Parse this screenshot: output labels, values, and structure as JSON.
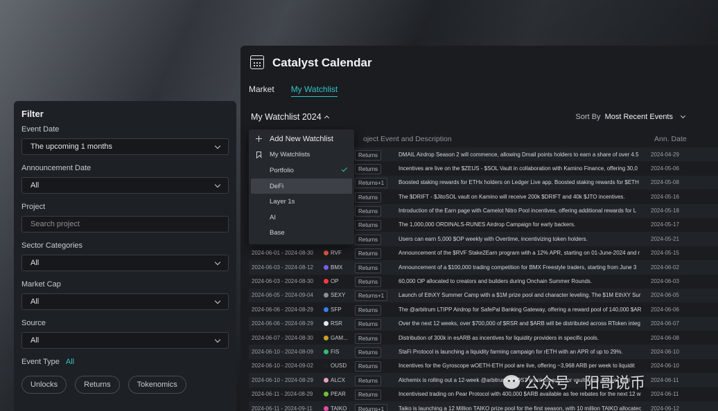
{
  "filter": {
    "title": "Filter",
    "event_date_label": "Event Date",
    "event_date_value": "The upcoming 1 months",
    "announcement_date_label": "Announcement Date",
    "announcement_date_value": "All",
    "project_label": "Project",
    "project_placeholder": "Search project",
    "sector_label": "Sector Categories",
    "sector_value": "All",
    "market_cap_label": "Market Cap",
    "market_cap_value": "All",
    "source_label": "Source",
    "source_value": "All",
    "event_type_label": "Event Type",
    "event_type_value": "All",
    "chips": [
      "Unlocks",
      "Returns",
      "Tokenomics"
    ]
  },
  "main": {
    "title": "Catalyst Calendar",
    "tabs": [
      "Market",
      "My Watchlist"
    ],
    "watchlist_select": "My Watchlist 2024",
    "sort_label": "Sort By",
    "sort_value": "Most Recent Events",
    "columns": {
      "project": "oject",
      "event": "Event and Description",
      "ann_date": "Ann. Date"
    }
  },
  "dropdown": {
    "add": "Add New Watchlist",
    "my_watchlists": "My Watchlists",
    "items": [
      "Portfolio",
      "DeFi",
      "Layer 1s",
      "AI",
      "Base"
    ]
  },
  "rows": [
    {
      "date": "",
      "project": "",
      "color": "",
      "type": "Returns",
      "desc": "DMAIL Airdrop Season 2 will commence, allowing Dmail points holders to earn a share of over 4.5",
      "ann": "2024-04-29"
    },
    {
      "date": "",
      "project": "",
      "color": "",
      "type": "Returns",
      "desc": "Incentives are live on the $ZEUS - $SOL Vault in collaboration with Kamino Finance, offering 30,0",
      "ann": "2024-05-06"
    },
    {
      "date": "",
      "project": "",
      "color": "",
      "type": "Returns+1",
      "desc": "Boosted staking rewards for ETHx holders on Ledger Live app. Boosted staking rewards for $ETH",
      "ann": "2024-05-08"
    },
    {
      "date": "",
      "project": "",
      "color": "",
      "type": "Returns",
      "desc": "The $DRIFT - $JitoSOL vault on Kamino will receive 200k $DRIFT and 40k $JTO incentives.",
      "ann": "2024-05-16"
    },
    {
      "date": "",
      "project": "",
      "color": "",
      "type": "Returns",
      "desc": "Introduction of the Earn page with Camelot Nitro Pool incentives, offering additional rewards for L",
      "ann": "2024-05-18"
    },
    {
      "date": "",
      "project": "",
      "color": "",
      "type": "Returns",
      "desc": "The 1,000,000 ORDINALS-RUNES Airdrop Campaign for early backers.",
      "ann": "2024-05-17"
    },
    {
      "date": "",
      "project": "",
      "color": "",
      "type": "Returns",
      "desc": "Users can earn 5,000 $OP weekly with Overtime, incentivizing token holders.",
      "ann": "2024-05-21"
    },
    {
      "date": "2024-06-01 - 2024-08-30",
      "project": "RVF",
      "color": "#e0533d",
      "type": "Returns",
      "desc": "Announcement of the $RVF Stake2Earn program with a 12% APR, starting on 01-June-2024 and r",
      "ann": "2024-05-15"
    },
    {
      "date": "2024-06-03 - 2024-08-12",
      "project": "BMX",
      "color": "#7a5cf0",
      "type": "Returns",
      "desc": "Announcement of a $100,000 trading competition for BMX Freestyle traders, starting from June 3",
      "ann": "2024-06-02"
    },
    {
      "date": "2024-06-03 - 2024-08-30",
      "project": "OP",
      "color": "#ff3b3b",
      "type": "Returns",
      "desc": "60,000 OP allocated to creators and builders during Onchain Summer Rounds.",
      "ann": "2024-06-03"
    },
    {
      "date": "2024-06-05 - 2024-09-04",
      "project": "SEXY",
      "color": "#8a8f96",
      "type": "Returns+1",
      "desc": "Launch of EthXY Summer Camp with a $1M prize pool and character leveling. The $1M EthXY Sur",
      "ann": "2024-06-05"
    },
    {
      "date": "2024-06-06 - 2024-08-29",
      "project": "SFP",
      "color": "#3d7bf5",
      "type": "Returns",
      "desc": "The @arbitrum LTIPP Airdrop for SafePal Banking Gateway, offering a reward pool of 140,000 $AR",
      "ann": "2024-06-06"
    },
    {
      "date": "2024-06-06 - 2024-08-29",
      "project": "RSR",
      "color": "#e8e8e8",
      "type": "Returns",
      "desc": "Over the next 12 weeks, over $700,000 of $RSR and $ARB will be distributed across RToken integ",
      "ann": "2024-06-07"
    },
    {
      "date": "2024-06-07 - 2024-08-30",
      "project": "GAM...",
      "color": "#c9a227",
      "type": "Returns",
      "desc": "Distribution of 300k in esARB as incentives for liquidity providers in specific pools.",
      "ann": "2024-06-08"
    },
    {
      "date": "2024-06-10 - 2024-08-09",
      "project": "FIS",
      "color": "#2fbf71",
      "type": "Returns",
      "desc": "StaFi Protocol is launching a liquidity farming campaign for rETH with an APR of up to 29%.",
      "ann": "2024-06-10"
    },
    {
      "date": "2024-06-10 - 2024-09-02",
      "project": "OUSD",
      "color": "#1f1f1f",
      "type": "Returns",
      "desc": "Incentives for the Gyroscope wOETH-ETH pool are live, offering ~3,968 ARB per week to liquidit",
      "ann": "2024-06-10"
    },
    {
      "date": "2024-06-10 - 2024-08-29",
      "project": "ALCX",
      "color": "#e8a0b4",
      "type": "Returns",
      "desc": "Alchemix is rolling out a 12-week @arbitrum BOOST grant program for vaults and alAsset liqui",
      "ann": "2024-06-11"
    },
    {
      "date": "2024-06-11 - 2024-08-29",
      "project": "PEAR",
      "color": "#6fc23a",
      "type": "Returns",
      "desc": "Incentivised trading on Pear Protocol with 400,000 $ARB available as fee rebates for the next 12 w",
      "ann": "2024-06-11"
    },
    {
      "date": "2024-06-11 - 2024-09-11",
      "project": "TAIKO",
      "color": "#e54aa8",
      "type": "Returns+1",
      "desc": "Taiko is launching a 12 Million TAIKO prize pool for the first season, with 10 million TAIKO allocatec",
      "ann": "2024-06-12"
    }
  ],
  "watermark": "公众号 · 阳哥说币"
}
